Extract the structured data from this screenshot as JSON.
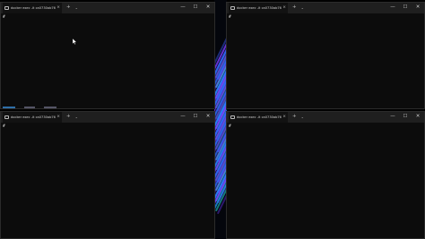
{
  "windows": {
    "top_left": {
      "tab_title": "docker exec -it ca0730ab7697",
      "tab_close": "×",
      "new_tab": "+",
      "dropdown": "⌄",
      "minimize": "—",
      "maximize": "☐",
      "close": "✕",
      "prompt": "#"
    },
    "top_right": {
      "tab_title": "docker exec -it ca0730ab7697",
      "tab_close": "×",
      "new_tab": "+",
      "dropdown": "⌄",
      "minimize": "—",
      "maximize": "☐",
      "close": "✕",
      "prompt": "#"
    },
    "bottom_left": {
      "tab_title": "docker exec -it ca0730ab7697",
      "tab_close": "×",
      "new_tab": "+",
      "dropdown": "⌄",
      "minimize": "—",
      "maximize": "☐",
      "close": "✕",
      "prompt": "#"
    },
    "bottom_right": {
      "tab_title": "docker exec -it ca0730ab7697",
      "tab_close": "×",
      "new_tab": "+",
      "dropdown": "⌄",
      "minimize": "—",
      "maximize": "☐",
      "close": "✕",
      "prompt": "#"
    }
  },
  "colors": {
    "terminal_bg": "#0c0c0c",
    "titlebar_bg": "#1f1f1f",
    "wallpaper_glow": [
      "#3b5bff",
      "#7a3cff",
      "#1ea0ff",
      "#21c4c4",
      "#5a2bd6"
    ]
  },
  "icons": {
    "tab_icon": "terminal-icon",
    "cursor": "mouse-pointer-icon"
  }
}
